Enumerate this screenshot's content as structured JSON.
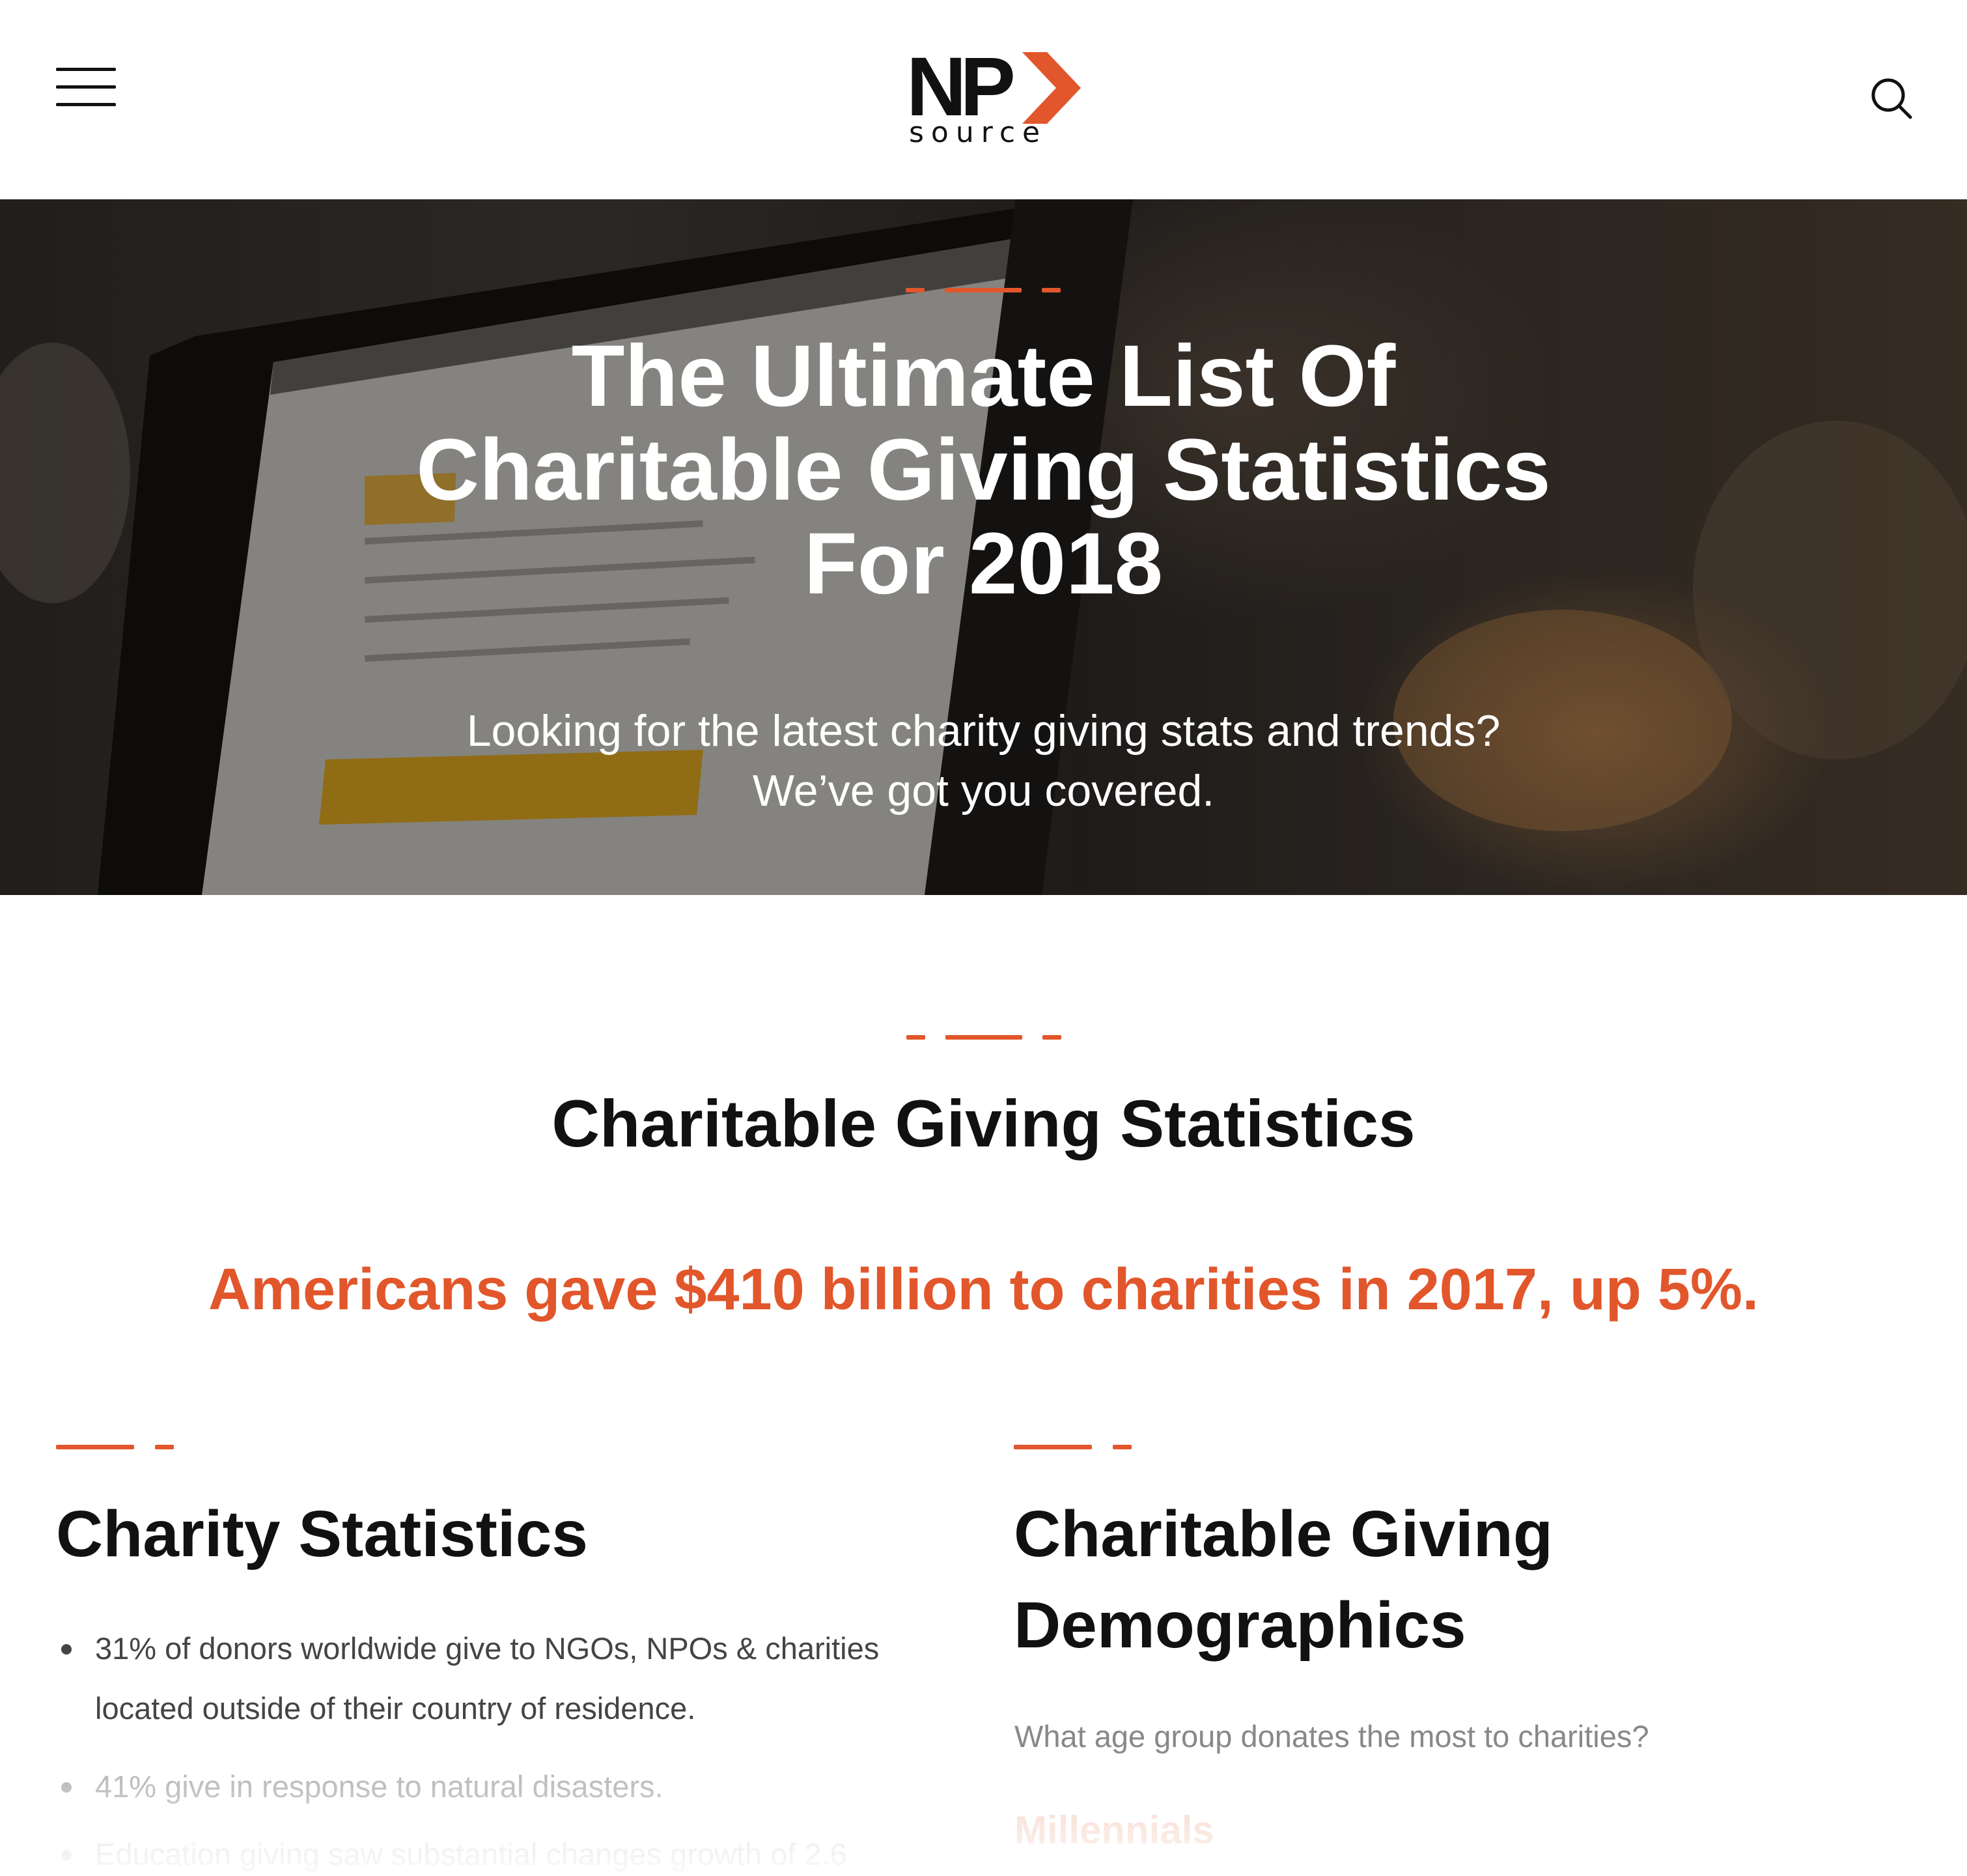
{
  "header": {
    "menu_icon": "hamburger-menu-icon",
    "logo": {
      "main": "NP",
      "sub": "source"
    },
    "search_icon": "search-icon"
  },
  "hero": {
    "title_lines": [
      "The Ultimate List Of",
      "Charitable Giving Statistics",
      "For 2018"
    ],
    "subtitle_lines": [
      "Looking for the latest charity giving stats and trends?",
      "We’ve got you covered."
    ]
  },
  "main": {
    "section_title": "Charitable Giving Statistics",
    "highlight": "Americans gave $410 billion to charities in 2017, up 5%.",
    "left_column": {
      "title": "Charity Statistics",
      "items": [
        "31% of donors worldwide give to NGOs, NPOs & charities located outside of their country of residence.",
        "41% give in response to natural disasters.",
        "Education giving saw substantial changes growth of 2.6"
      ]
    },
    "right_column": {
      "title_lines": [
        "Charitable Giving",
        "Demographics"
      ],
      "question": "What age group donates the most to charities?",
      "subhead": "Millennials"
    }
  },
  "colors": {
    "accent": "#e2562b",
    "text": "#111111",
    "muted": "#888888"
  }
}
